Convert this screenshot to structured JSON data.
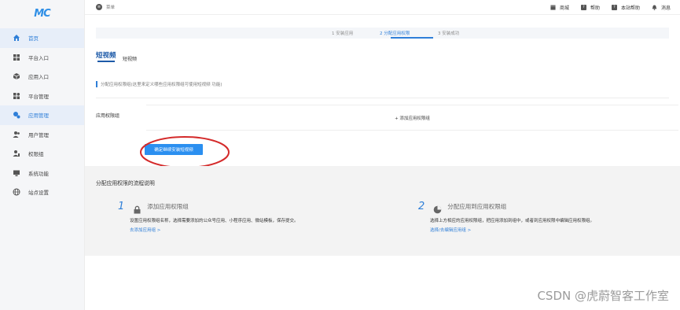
{
  "brand": {
    "logo_text": "MC",
    "accent": "#2f7fd8"
  },
  "sidebar": {
    "items": [
      {
        "label": "首页",
        "icon": "home-icon",
        "active": true
      },
      {
        "label": "平台入口",
        "icon": "grid-icon",
        "active": false
      },
      {
        "label": "应用入口",
        "icon": "cube-icon",
        "active": false
      },
      {
        "label": "平台管理",
        "icon": "apps-icon",
        "active": false
      },
      {
        "label": "应用管理",
        "icon": "apps-gear-icon",
        "active": true
      },
      {
        "label": "用户管理",
        "icon": "users-icon",
        "active": false
      },
      {
        "label": "权限组",
        "icon": "user-key-icon",
        "active": false
      },
      {
        "label": "系统功能",
        "icon": "monitor-icon",
        "active": false
      },
      {
        "label": "站点设置",
        "icon": "globe-icon",
        "active": false
      }
    ]
  },
  "topbar": {
    "menu_label": "菜单",
    "links": [
      {
        "label": "商城",
        "icon": "store-icon"
      },
      {
        "label": "帮助",
        "icon": "help-icon"
      },
      {
        "label": "本站帮助",
        "icon": "site-help-icon"
      },
      {
        "label": "消息",
        "icon": "bell-icon"
      }
    ]
  },
  "steps": [
    "1 安装应用",
    "2 分配应用权限",
    "3 安装成功"
  ],
  "app": {
    "logo_text": "短视频",
    "name": "短视频"
  },
  "hint": "分配应用权限组(这里来定义哪些应用权限组可使用短视频 功能)",
  "form": {
    "perm_label": "应用权限组",
    "add_group_label": "+ 添加应用权限组",
    "confirm_label": "确定继续安装短视频"
  },
  "flow": {
    "title": "分配应用权限的流程说明",
    "steps": [
      {
        "num": "1",
        "title": "添加应用权限组",
        "desc": "设置应用权限组名称，选择需要添加的公众号应用、小程序应用、微站模板，保存提交。",
        "link": "去添加应用组 >",
        "icon": "lock-icon"
      },
      {
        "num": "2",
        "title": "分配应用到应用权限组",
        "desc": "选择上方相应的应用权限组，把应用添加到组中，或者到应用权限中编辑应用权限组。",
        "link": "选择/去编辑应用组 >",
        "icon": "pie-icon"
      }
    ]
  },
  "watermark": "CSDN @虎蔚智客工作室"
}
